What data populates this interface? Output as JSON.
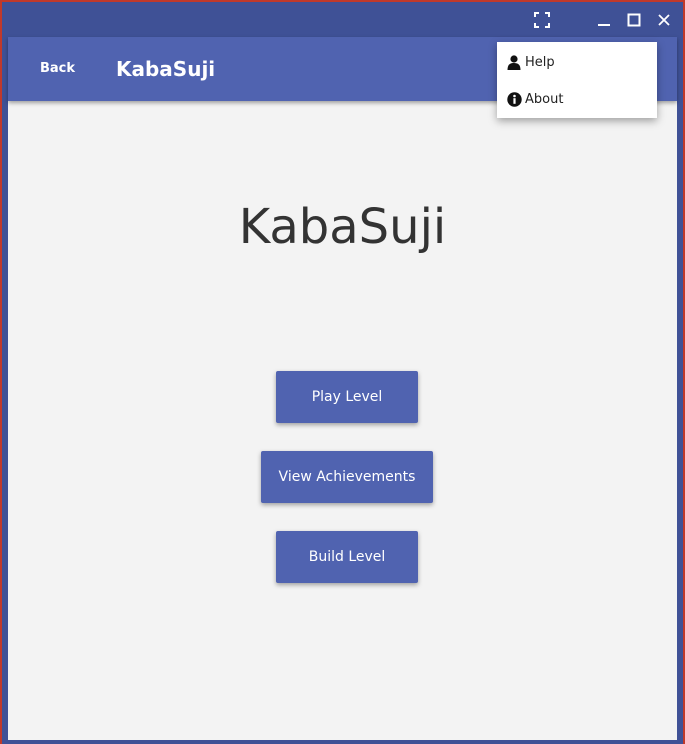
{
  "window": {
    "controls": [
      "fullscreen-icon",
      "minimize-icon",
      "maximize-icon",
      "close-icon"
    ]
  },
  "appbar": {
    "back_label": "Back",
    "title": "KabaSuji"
  },
  "main": {
    "title": "KabaSuji",
    "buttons": [
      {
        "label": "Play Level"
      },
      {
        "label": "View Achievements"
      },
      {
        "label": "Build Level"
      }
    ]
  },
  "menu": {
    "items": [
      {
        "label": "Help",
        "icon": "user-icon"
      },
      {
        "label": "About",
        "icon": "info-icon"
      }
    ]
  },
  "colors": {
    "accent": "#5063b0",
    "titlebar": "#3f5196",
    "background": "#f3f3f3",
    "frame": "#c0392b"
  }
}
